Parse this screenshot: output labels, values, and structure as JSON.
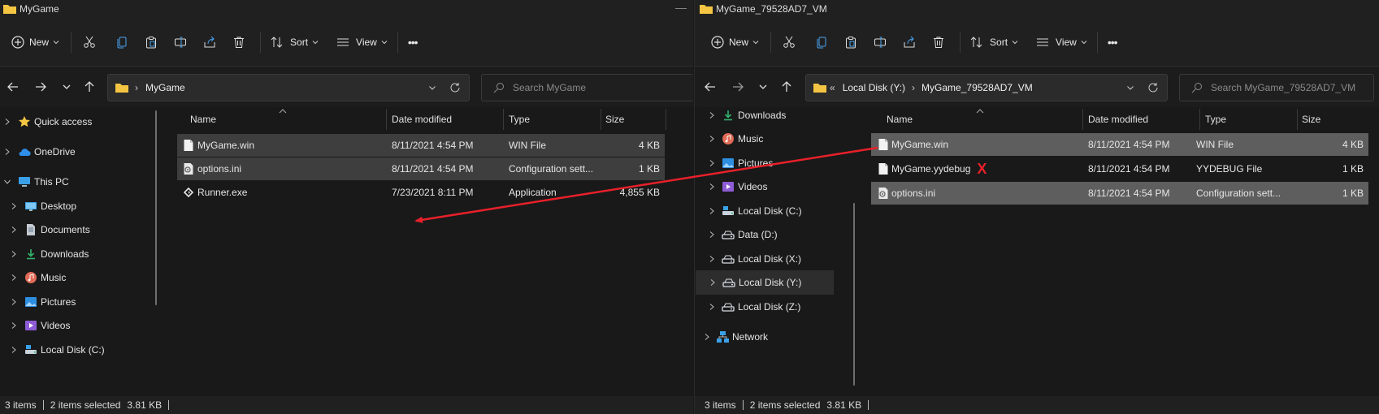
{
  "left": {
    "title": "MyGame",
    "cmd": {
      "new_label": "New",
      "sort_label": "Sort",
      "view_label": "View",
      "more": "•••"
    },
    "address": {
      "crumbs": [
        "MyGame"
      ]
    },
    "search": {
      "placeholder": "Search MyGame"
    },
    "nav": [
      {
        "label": "Quick access",
        "icon": "star-icon"
      },
      {
        "label": "OneDrive",
        "icon": "cloud-icon"
      },
      {
        "label": "This PC",
        "icon": "pc-icon"
      },
      {
        "label": "Desktop",
        "icon": "desktop-icon"
      },
      {
        "label": "Documents",
        "icon": "documents-icon"
      },
      {
        "label": "Downloads",
        "icon": "download-icon"
      },
      {
        "label": "Music",
        "icon": "music-icon"
      },
      {
        "label": "Pictures",
        "icon": "pictures-icon"
      },
      {
        "label": "Videos",
        "icon": "videos-icon"
      },
      {
        "label": "Local Disk (C:)",
        "icon": "drive-c-icon"
      }
    ],
    "columns": [
      "Name",
      "Date modified",
      "Type",
      "Size"
    ],
    "files": [
      {
        "name": "MyGame.win",
        "date": "8/11/2021 4:54 PM",
        "type": "WIN File",
        "size": "4 KB",
        "selected": true
      },
      {
        "name": "options.ini",
        "date": "8/11/2021 4:54 PM",
        "type": "Configuration sett...",
        "size": "1 KB",
        "selected": true
      },
      {
        "name": "Runner.exe",
        "date": "7/23/2021 8:11 PM",
        "type": "Application",
        "size": "4,855 KB",
        "selected": false
      }
    ],
    "status": {
      "items": "3 items",
      "selected": "2 items selected",
      "size": "3.81 KB"
    }
  },
  "right": {
    "title": "MyGame_79528AD7_VM",
    "cmd": {
      "new_label": "New",
      "sort_label": "Sort",
      "view_label": "View",
      "more": "•••"
    },
    "address": {
      "overflow": "«",
      "crumbs": [
        "Local Disk (Y:)",
        "MyGame_79528AD7_VM"
      ]
    },
    "search": {
      "placeholder": "Search MyGame_79528AD7_VM"
    },
    "nav": [
      {
        "label": "Downloads",
        "icon": "download-icon"
      },
      {
        "label": "Music",
        "icon": "music-icon"
      },
      {
        "label": "Pictures",
        "icon": "pictures-icon"
      },
      {
        "label": "Videos",
        "icon": "videos-icon"
      },
      {
        "label": "Local Disk (C:)",
        "icon": "drive-c-icon"
      },
      {
        "label": "Data (D:)",
        "icon": "drive-icon"
      },
      {
        "label": "Local Disk (X:)",
        "icon": "drive-icon"
      },
      {
        "label": "Local Disk (Y:)",
        "icon": "drive-icon",
        "selected": true
      },
      {
        "label": "Local Disk (Z:)",
        "icon": "drive-icon"
      },
      {
        "label": "Network",
        "icon": "network-icon"
      }
    ],
    "columns": [
      "Name",
      "Date modified",
      "Type",
      "Size"
    ],
    "files": [
      {
        "name": "MyGame.win",
        "date": "8/11/2021 4:54 PM",
        "type": "WIN File",
        "size": "4 KB",
        "selected": true
      },
      {
        "name": "MyGame.yydebug",
        "date": "8/11/2021 4:54 PM",
        "type": "YYDEBUG File",
        "size": "1 KB",
        "selected": false,
        "mark": "X"
      },
      {
        "name": "options.ini",
        "date": "8/11/2021 4:54 PM",
        "type": "Configuration sett...",
        "size": "1 KB",
        "selected": true
      }
    ],
    "status": {
      "items": "3 items",
      "selected": "2 items selected",
      "size": "3.81 KB"
    }
  },
  "colors": {
    "annotation_red": "#e8202a",
    "folder_yellow": "#f4c542",
    "accent_blue": "#4aa3f0"
  }
}
